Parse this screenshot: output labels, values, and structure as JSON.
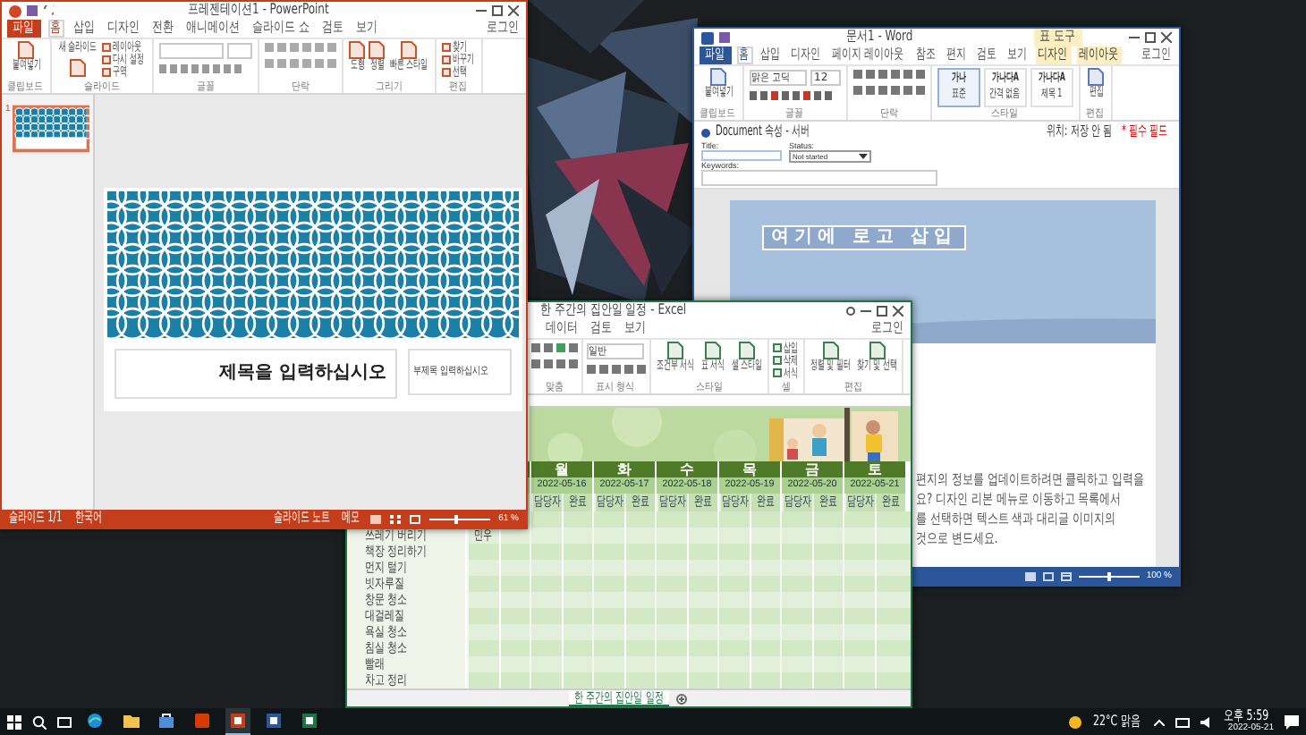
{
  "powerpoint": {
    "title": "프레젠테이션1 - PowerPoint",
    "signin": "로그인",
    "tabs": [
      {
        "label": "파일",
        "selected": false,
        "kind": "file"
      },
      {
        "label": "홈",
        "selected": true,
        "kind": "tab"
      },
      {
        "label": "삽입",
        "selected": false,
        "kind": "tab"
      },
      {
        "label": "디자인",
        "selected": false,
        "kind": "tab"
      },
      {
        "label": "전환",
        "selected": false,
        "kind": "tab"
      },
      {
        "label": "애니메이션",
        "selected": false,
        "kind": "tab"
      },
      {
        "label": "슬라이드 쇼",
        "selected": false,
        "kind": "tab"
      },
      {
        "label": "검토",
        "selected": false,
        "kind": "tab"
      },
      {
        "label": "보기",
        "selected": false,
        "kind": "tab"
      }
    ],
    "groups": [
      {
        "label": "클립보드",
        "buttons": [
          {
            "label": "붙여넣기",
            "kind": "large"
          }
        ]
      },
      {
        "label": "슬라이드",
        "buttons": [
          {
            "label": "새 슬라이드",
            "kind": "large"
          },
          {
            "label": "레이아웃",
            "kind": "small"
          },
          {
            "label": "다시 설정",
            "kind": "small"
          },
          {
            "label": "구역",
            "kind": "small"
          }
        ]
      },
      {
        "label": "글꼴",
        "kind": "font"
      },
      {
        "label": "단락",
        "kind": "paragraph"
      },
      {
        "label": "그리기",
        "buttons": [
          {
            "label": "도형",
            "kind": "large"
          },
          {
            "label": "정렬",
            "kind": "large"
          },
          {
            "label": "빠른 스타일",
            "kind": "large"
          }
        ]
      },
      {
        "label": "편집",
        "buttons": [
          {
            "label": "찾기",
            "kind": "small"
          },
          {
            "label": "바꾸기",
            "kind": "small"
          },
          {
            "label": "선택",
            "kind": "small"
          }
        ]
      }
    ],
    "thumbnails": [
      {
        "number": "1",
        "selected": true
      }
    ],
    "slide": {
      "title": "제목을 입력하십시오",
      "subtitle": "부제목 입력하십시오"
    },
    "status": {
      "slide": "슬라이드 1/1",
      "language": "한국어",
      "notes": "슬라이드 노트",
      "comments": "메모",
      "zoom": "61 %"
    },
    "zoom_slider": {
      "level": 0.45
    }
  },
  "word": {
    "title": "문서1 - Word",
    "context_label": "표 도구",
    "signin": "로그인",
    "tabs": [
      {
        "label": "파일",
        "selected": false,
        "kind": "file"
      },
      {
        "label": "홈",
        "selected": true,
        "kind": "tab"
      },
      {
        "label": "삽입",
        "selected": false,
        "kind": "tab"
      },
      {
        "label": "디자인",
        "selected": false,
        "kind": "tab"
      },
      {
        "label": "페이지 레이아웃",
        "selected": false,
        "kind": "tab"
      },
      {
        "label": "참조",
        "selected": false,
        "kind": "tab"
      },
      {
        "label": "편지",
        "selected": false,
        "kind": "tab"
      },
      {
        "label": "검토",
        "selected": false,
        "kind": "tab"
      },
      {
        "label": "보기",
        "selected": false,
        "kind": "tab"
      },
      {
        "label": "디자인",
        "selected": false,
        "kind": "context"
      },
      {
        "label": "레이아웃",
        "selected": false,
        "kind": "context"
      }
    ],
    "font_name": "맑은 고딕",
    "font_size": "12",
    "groups": [
      {
        "label": "클립보드",
        "buttons": [
          {
            "label": "붙여넣기",
            "kind": "large"
          }
        ]
      },
      {
        "label": "글꼴",
        "kind": "font"
      },
      {
        "label": "단락",
        "kind": "paragraph"
      },
      {
        "label": "스타일",
        "styles": [
          {
            "preview": "가나",
            "name": "표준",
            "selected": true
          },
          {
            "preview": "가나다A",
            "name": "간격 없음",
            "selected": false
          },
          {
            "preview": "가나다A",
            "name": "제목 1",
            "selected": false
          }
        ]
      },
      {
        "label": "편집",
        "buttons": [
          {
            "label": "편집",
            "kind": "large"
          }
        ]
      }
    ],
    "properties": {
      "title": "Document 속성 - 서버",
      "location": "위치: 저장 안 됨",
      "required": "* 필수 필드",
      "fields": [
        {
          "label": "Title:",
          "kind": "text"
        },
        {
          "label": "Status:",
          "kind": "select",
          "value": "Not started"
        },
        {
          "label": "Keywords:",
          "kind": "area"
        }
      ]
    },
    "logo_placeholder": "여기에 로고 삽입",
    "body_lines": [
      "편지의 정보를 업데이트하려면 클릭하고 입력을",
      "요? 디자인 리본 메뉴로 이동하고 목록에서",
      "를 선택하면 텍스트 색과 대리글 이미지의",
      "것으로 변드세요."
    ],
    "zoom": "100 %",
    "zoom_slider": {
      "level": 0.5
    }
  },
  "excel": {
    "title": "한 주간의 집안일 일정 - Excel",
    "signin": "로그인",
    "tabs": [
      {
        "label": "데이터",
        "selected": false
      },
      {
        "label": "검토",
        "selected": false
      },
      {
        "label": "보기",
        "selected": false
      }
    ],
    "number_format": "일반",
    "groups": [
      {
        "label": "맞춤",
        "kind": "align"
      },
      {
        "label": "표시 형식",
        "kind": "number"
      },
      {
        "label": "스타일",
        "buttons": [
          {
            "label": "조건부 서식",
            "kind": "large"
          },
          {
            "label": "표 서식",
            "kind": "large"
          },
          {
            "label": "셀 스타일",
            "kind": "large"
          }
        ]
      },
      {
        "label": "셀",
        "buttons": [
          {
            "label": "삽입",
            "kind": "small"
          },
          {
            "label": "삭제",
            "kind": "small"
          },
          {
            "label": "서식",
            "kind": "small"
          }
        ]
      },
      {
        "label": "편집",
        "buttons": [
          {
            "label": "정렬 및 필터",
            "kind": "large"
          },
          {
            "label": "찾기 및 선택",
            "kind": "large"
          }
        ]
      }
    ],
    "days": [
      {
        "day": "월",
        "date": "2022-05-16",
        "subheaders": [
          "담당자",
          "완료"
        ]
      },
      {
        "day": "화",
        "date": "2022-05-17",
        "subheaders": [
          "담당자",
          "완료"
        ]
      },
      {
        "day": "수",
        "date": "2022-05-18",
        "subheaders": [
          "담당자",
          "완료"
        ]
      },
      {
        "day": "목",
        "date": "2022-05-19",
        "subheaders": [
          "담당자",
          "완료"
        ]
      },
      {
        "day": "금",
        "date": "2022-05-20",
        "subheaders": [
          "담당자",
          "완료"
        ]
      },
      {
        "day": "토",
        "date": "2022-05-21",
        "subheaders": [
          "담당자",
          "완료"
        ]
      }
    ],
    "tasks": [
      {
        "name": "쓰레기 버리기",
        "cells": [
          "민우"
        ]
      },
      {
        "name": "책장 정리하기"
      },
      {
        "name": "먼지 털기"
      },
      {
        "name": "빗자루질"
      },
      {
        "name": "창문 청소"
      },
      {
        "name": "대걸레질"
      },
      {
        "name": "욕실 청소"
      },
      {
        "name": "침실 청소"
      },
      {
        "name": "빨래"
      },
      {
        "name": "차고 정리"
      }
    ],
    "sheet_tabs": [
      {
        "label": "한 주간의 집안일 일정",
        "selected": true
      }
    ]
  },
  "taskbar": {
    "apps": [
      {
        "kind": "browser",
        "selected": false
      },
      {
        "kind": "folder",
        "selected": false
      },
      {
        "kind": "store",
        "selected": false
      },
      {
        "kind": "office",
        "selected": false
      },
      {
        "kind": "powerpoint",
        "selected": true
      },
      {
        "kind": "word",
        "selected": false
      },
      {
        "kind": "excel",
        "selected": false
      }
    ],
    "weather": "22°C 맑음",
    "time": "오후 5:59",
    "date": "2022-05-21"
  }
}
